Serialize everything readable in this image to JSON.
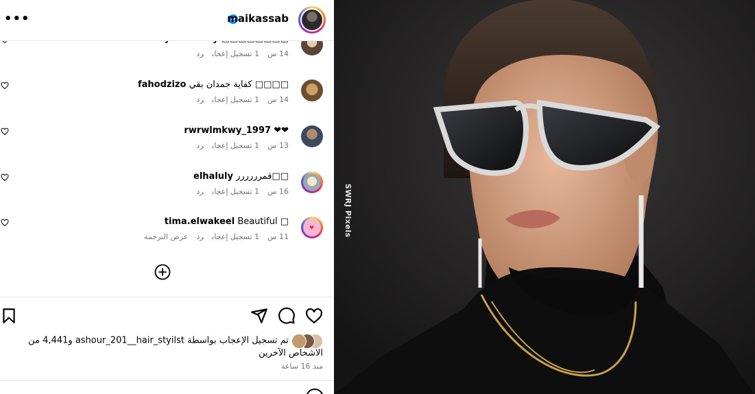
{
  "post_header": {
    "username": "maikassab",
    "verified": true,
    "more_label": "•••"
  },
  "comments": [
    {
      "username": "sallyelbatouty",
      "text": "□□□□□□□□",
      "time": "14 س",
      "likes": "1 تسجيل إعجاب",
      "reply": "رد",
      "translate": ""
    },
    {
      "username": "fahodzizo",
      "text": "كفاية جمدان بقي □□□□",
      "time": "14 س",
      "likes": "1 تسجيل إعجاب",
      "reply": "رد",
      "translate": ""
    },
    {
      "username": "rwrwlmkwy_1997",
      "text": "❤❤",
      "time": "13 س",
      "likes": "1 تسجيل إعجاب",
      "reply": "رد",
      "translate": ""
    },
    {
      "username": "elhaluly",
      "text": "قمرررررر□□",
      "time": "16 س",
      "likes": "1 تسجيل إعجاب",
      "reply": "رد",
      "translate": ""
    },
    {
      "username": "tima.elwakeel",
      "text": "Beautiful □",
      "time": "11 س",
      "likes": "1 تسجيل إعجاب",
      "reply": "رد",
      "translate": "عرض الترجمة"
    }
  ],
  "likes_summary": "تم تسجيل الإعجاب بواسطة ashour_201__hair_styilst و4,441 من الأشخاص الآخرين",
  "post_time": "منذ 16 ساعة",
  "photo": {
    "watermark": "SWRJ Pixels"
  }
}
